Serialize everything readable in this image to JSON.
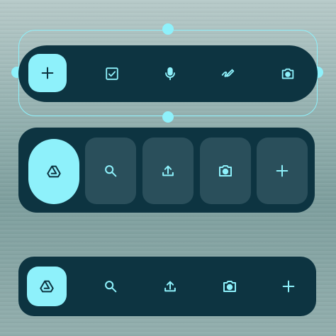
{
  "colors": {
    "surface": "#0d3441",
    "accent": "#8ef1fb",
    "tile": "#2a4f5b"
  },
  "toolbar_floating": {
    "selected": true,
    "items": [
      {
        "icon": "plus-icon",
        "style": "filled-square"
      },
      {
        "icon": "checkbox-icon"
      },
      {
        "icon": "microphone-icon"
      },
      {
        "icon": "draw-icon"
      },
      {
        "icon": "camera-icon"
      }
    ]
  },
  "toolbar_tiles": {
    "items": [
      {
        "icon": "drive-icon",
        "style": "filled-pill"
      },
      {
        "icon": "search-icon"
      },
      {
        "icon": "upload-icon"
      },
      {
        "icon": "camera-icon"
      },
      {
        "icon": "plus-icon"
      }
    ]
  },
  "toolbar_compact": {
    "items": [
      {
        "icon": "drive-icon",
        "style": "filled-square"
      },
      {
        "icon": "search-icon"
      },
      {
        "icon": "upload-icon"
      },
      {
        "icon": "camera-icon"
      },
      {
        "icon": "plus-icon"
      }
    ]
  }
}
